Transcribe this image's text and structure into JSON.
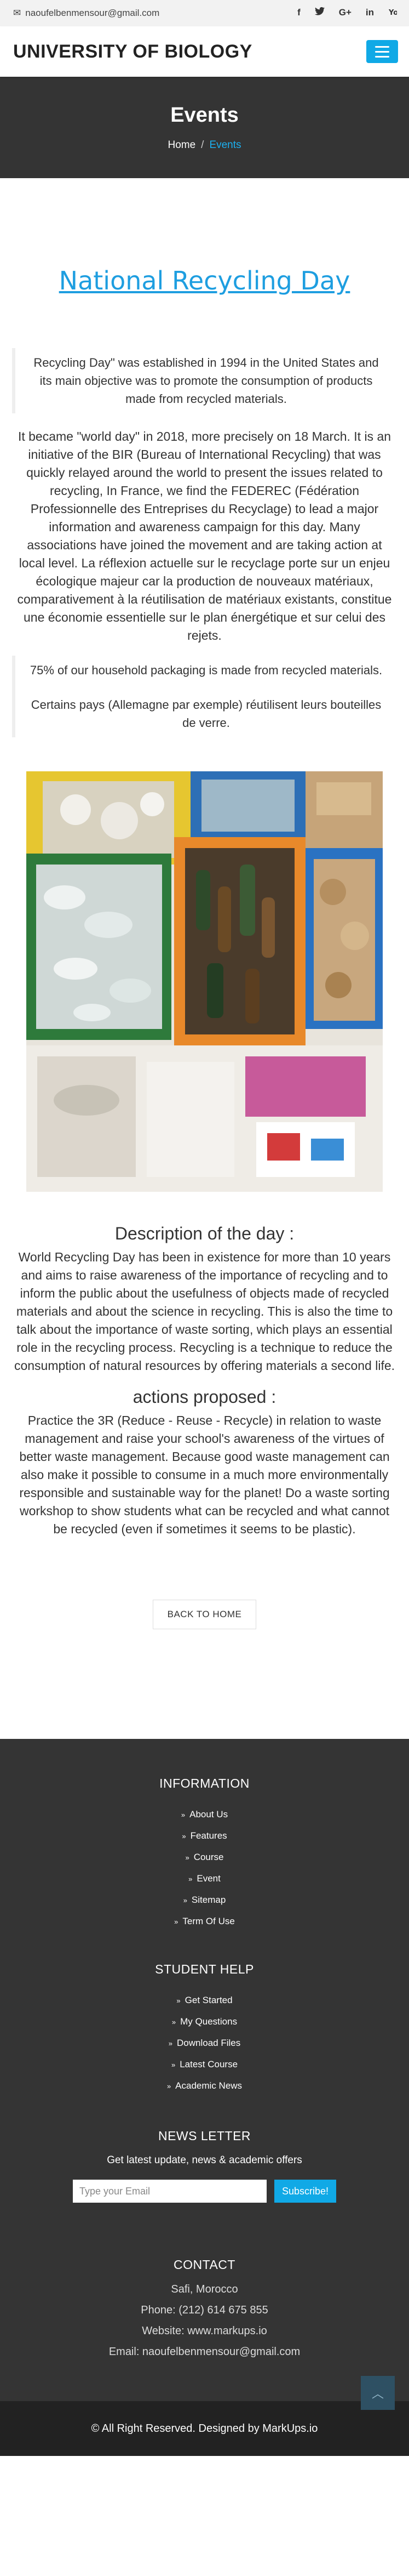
{
  "topbar": {
    "email": "naoufelbenmensour@gmail.com",
    "social": [
      {
        "icon": "facebook-icon",
        "glyph": "f"
      },
      {
        "icon": "twitter-icon",
        "glyph": "🐦"
      },
      {
        "icon": "google-plus-icon",
        "glyph": "G+"
      },
      {
        "icon": "linkedin-icon",
        "glyph": "in"
      },
      {
        "icon": "youtube-icon",
        "glyph": "▶"
      }
    ]
  },
  "header": {
    "brand": "UNIVERSITY OF BIOLOGY",
    "menu_icon": "hamburger-menu-icon"
  },
  "banner": {
    "title": "Events",
    "breadcrumb_home": "Home",
    "breadcrumb_sep": "/",
    "breadcrumb_current": "Events"
  },
  "article": {
    "title": "National Recycling Day",
    "quote1": "Recycling Day\" was established in 1994 in the United States and its main objective was to promote the consumption of products made from recycled materials.",
    "para1": "It became \"world day\" in 2018, more precisely on 18 March. It is an initiative of the BIR (Bureau of International Recycling) that was quickly relayed around the world to present the issues related to recycling, In France, we find the FEDEREC (Fédération Professionnelle des Entreprises du Recyclage) to lead a major information and awareness campaign for this day. Many associations have joined the movement and are taking action at local level. La réflexion actuelle sur le recyclage porte sur un enjeu écologique majeur car la production de nouveaux matériaux, comparativement à la réutilisation de matériaux existants, constitue une économie essentielle sur le plan énergétique et sur celui des rejets.",
    "quote2_line1": "75% of our household packaging is made from recycled materials.",
    "quote2_line2": "Certains pays (Allemagne par exemple) réutilisent leurs bouteilles de verre.",
    "description_title": "Description of the day :",
    "description_text": "World Recycling Day has been in existence for more than 10 years and aims to raise awareness of the importance of recycling and to inform the public about the usefulness of objects made of recycled materials and about the science in recycling. This is also the time to talk about the importance of waste sorting, which plays an essential role in the recycling process. Recycling is a technique to reduce the consumption of natural resources by offering materials a second life.",
    "actions_title": "actions proposed :",
    "actions_text": "Practice the 3R (Reduce - Reuse - Recycle) in relation to waste management and raise your school's awareness of the virtues of better waste management. Because good waste management can also make it possible to consume in a much more environmentally responsible and sustainable way for the planet! Do a waste sorting workshop to show students what can be recycled and what cannot be recycled (even if sometimes it seems to be plastic).",
    "back_button": "BACK TO HOME"
  },
  "footer": {
    "information_title": "INFORMATION",
    "information_links": [
      "About Us",
      "Features",
      "Course",
      "Event",
      "Sitemap",
      "Term Of Use"
    ],
    "student_help_title": "STUDENT HELP",
    "student_help_links": [
      "Get Started",
      "My Questions",
      "Download Files",
      "Latest Course",
      "Academic News"
    ],
    "newsletter_title": "NEWS LETTER",
    "newsletter_sub": "Get latest update, news & academic offers",
    "newsletter_placeholder": "Type your Email",
    "newsletter_button": "Subscribe!",
    "contact_title": "CONTACT",
    "contact_lines": [
      "Safi, Morocco",
      "Phone: (212) 614 675 855",
      "Website: www.markups.io",
      "Email: naoufelbenmensour@gmail.com"
    ],
    "copyright": "© All Right Reserved. Designed by MarkUps.io"
  },
  "colors": {
    "accent": "#10a9e6",
    "title_link": "#1e9ee0",
    "dark_bg": "#343434",
    "bottom_bg": "#222222"
  }
}
